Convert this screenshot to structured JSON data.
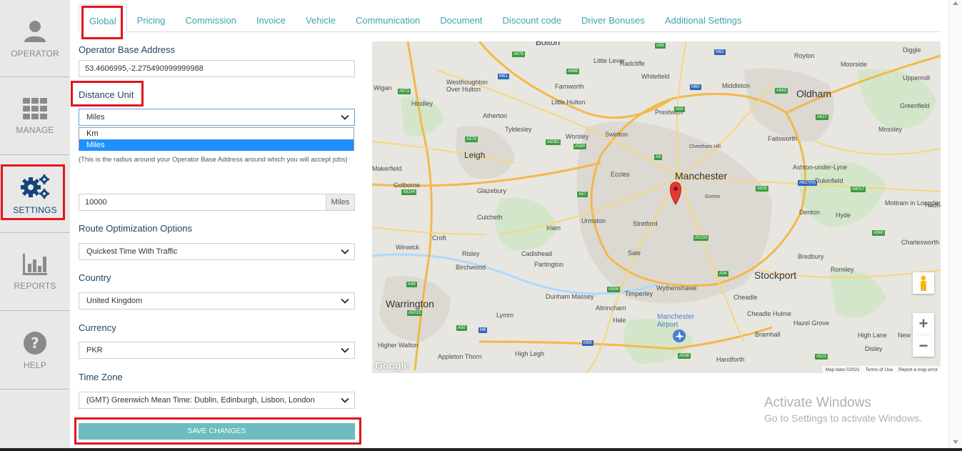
{
  "sidebar": {
    "items": [
      {
        "label": "OPERATOR",
        "icon": "user-icon"
      },
      {
        "label": "MANAGE",
        "icon": "grid-icon"
      },
      {
        "label": "SETTINGS",
        "icon": "gears-icon",
        "active": true
      },
      {
        "label": "REPORTS",
        "icon": "bar-chart-icon"
      },
      {
        "label": "HELP",
        "icon": "question-icon"
      }
    ]
  },
  "tabs": [
    {
      "label": "Global",
      "active": true
    },
    {
      "label": "Pricing"
    },
    {
      "label": "Commission"
    },
    {
      "label": "Invoice"
    },
    {
      "label": "Vehicle"
    },
    {
      "label": "Communication"
    },
    {
      "label": "Document"
    },
    {
      "label": "Discount code"
    },
    {
      "label": "Driver Bonuses"
    },
    {
      "label": "Additional Settings"
    }
  ],
  "form": {
    "base_address": {
      "label": "Operator Base Address",
      "value": "53.4606995,-2.275490999999988"
    },
    "distance_unit": {
      "label": "Distance Unit",
      "value": "Miles",
      "options": [
        "Km",
        "Miles"
      ],
      "selected": "Miles"
    },
    "radius_help": "(This is the radius around your Operator Base Address around which you will accept jobs)",
    "radius": {
      "value": "10000",
      "unit": "Miles"
    },
    "route_opt": {
      "label": "Route Optimization Options",
      "value": "Quickest Time With Traffic"
    },
    "country": {
      "label": "Country",
      "value": "United Kingdom"
    },
    "currency": {
      "label": "Currency",
      "value": "PKR"
    },
    "timezone": {
      "label": "Time Zone",
      "value": "(GMT) Greenwich Mean Time: Dublin, Edinburgh, Lisbon, London"
    },
    "save_label": "SAVE CHANGES"
  },
  "map": {
    "places_big": [
      "Manchester",
      "Oldham",
      "Stockport",
      "Warrington"
    ],
    "places": [
      "Bolton",
      "Little Lever",
      "Radcliffe",
      "Royton",
      "Moorside",
      "Diggle",
      "Uppermill",
      "Westhoughton",
      "Over Hulton",
      "Farnworth",
      "Whitefield",
      "Middleton",
      "Greenfield",
      "Wigan",
      "Hindley",
      "Little Hulton",
      "Prestwich",
      "Atherton",
      "Tyldesley",
      "Worsley",
      "Swinton",
      "Failsworth",
      "Mossley",
      "Leigh",
      "Ashton-under-Lyne",
      "Dukinfield",
      "Makerfield",
      "Golborne",
      "Glazebury",
      "Eccles",
      "Mottram in Longdendale",
      "Hadfield",
      "Denton",
      "Hyde",
      "Culcheth",
      "Urmston",
      "Stretford",
      "Croft",
      "Irlam",
      "Winwick",
      "Risley",
      "Cadishead",
      "Sale",
      "Charlesworth",
      "Birchwood",
      "Partington",
      "Bredbury",
      "Romiley",
      "Dunham Massey",
      "Timperley",
      "Wythenshawe",
      "Cheadle",
      "Altrincham",
      "Cheadle Hulme",
      "Lymm",
      "Hale",
      "Hazel Grove",
      "High Lane",
      "Bramhall",
      "Disley",
      "New Mills",
      "Higher Walton",
      "Appleton Thorn",
      "High Legh",
      "Handforth",
      "Cheetham Hill",
      "Gorton",
      "Manchester Airport"
    ],
    "attribution": [
      "Map data ©2021",
      "Terms of Use",
      "Report a map error"
    ],
    "logo": "Google",
    "road_labels": [
      "A676",
      "A56",
      "M62",
      "M61",
      "A666",
      "A58",
      "A6",
      "M60",
      "A663",
      "A573",
      "A627",
      "A5082",
      "A579",
      "A580",
      "A6144",
      "A6017",
      "A635",
      "A57",
      "A49",
      "M6",
      "A50",
      "A556",
      "A34",
      "A538",
      "A5103",
      "A560",
      "A627(M)",
      "M56",
      "A523",
      "A5013"
    ]
  },
  "watermark": {
    "title": "Activate Windows",
    "sub": "Go to Settings to activate Windows."
  }
}
